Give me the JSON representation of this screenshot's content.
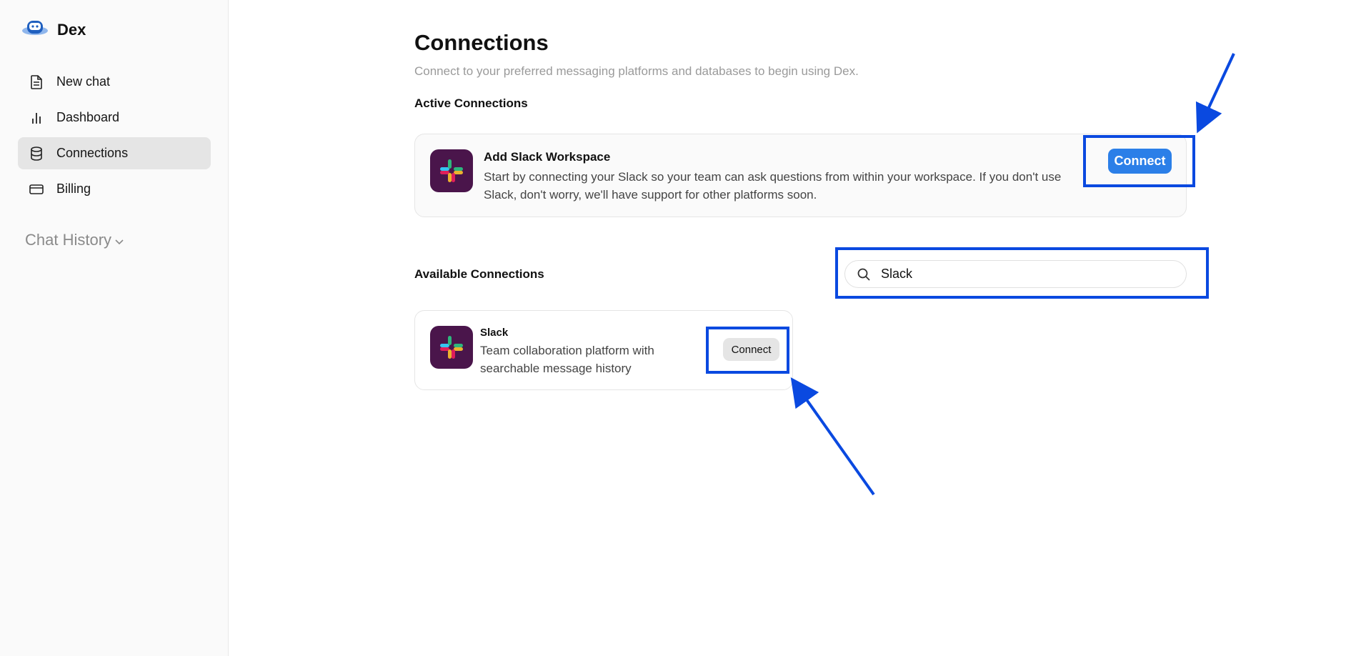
{
  "app": {
    "name": "Dex"
  },
  "sidebar": {
    "items": [
      {
        "label": "New chat",
        "icon": "document-icon"
      },
      {
        "label": "Dashboard",
        "icon": "bar-chart-icon"
      },
      {
        "label": "Connections",
        "icon": "database-icon",
        "active": true
      },
      {
        "label": "Billing",
        "icon": "credit-card-icon"
      }
    ],
    "history_label": "Chat History"
  },
  "main": {
    "title": "Connections",
    "subtitle": "Connect to your preferred messaging platforms and databases to begin using Dex.",
    "active_section": {
      "title": "Active Connections",
      "card": {
        "title": "Add Slack Workspace",
        "description": "Start by connecting your Slack so your team can ask questions from within your workspace. If you don't use Slack, don't worry, we'll have support for other platforms soon.",
        "button_label": "Connect"
      }
    },
    "available_section": {
      "title": "Available Connections",
      "search": {
        "value": "Slack",
        "placeholder": ""
      },
      "items": [
        {
          "name": "Slack",
          "description": "Team collaboration platform with searchable message history",
          "button_label": "Connect"
        }
      ]
    }
  },
  "colors": {
    "accent": "#2b7fe8",
    "annotation": "#0a49e0",
    "slack_bg": "#4a154b"
  }
}
